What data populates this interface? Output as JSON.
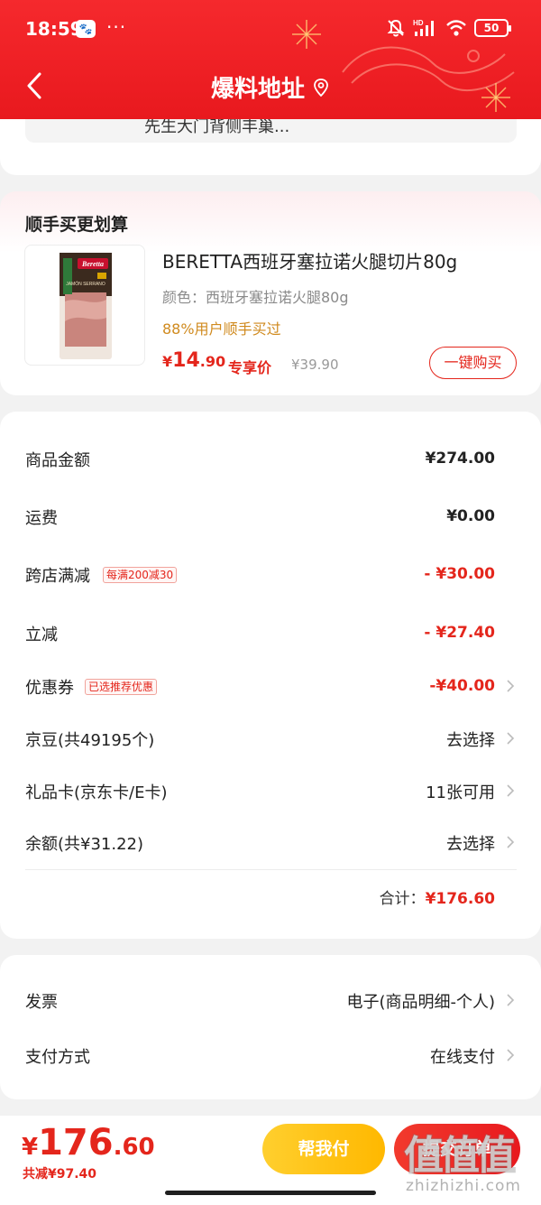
{
  "status_bar": {
    "time": "18:59",
    "app_badge": "🐾",
    "dots": "···",
    "network": "HD",
    "battery": "50"
  },
  "nav": {
    "title": "爆料地址"
  },
  "address": {
    "text": "先生大门背侧丰巢..."
  },
  "addon": {
    "section_title": "顺手买更划算",
    "product_name": "BERETTA西班牙塞拉诺火腿切片80g",
    "spec": "颜色：西班牙塞拉诺火腿80g",
    "bought_text": "88%用户顺手买过",
    "price_yen": "¥",
    "price_int": "14",
    "price_dec": ".90",
    "price_tag": "专享价",
    "original_price": "¥39.90",
    "buy_button": "一键购买",
    "image_brand": "Beretta",
    "image_caption": "JAMÓN SERRANO"
  },
  "summary": {
    "rows": [
      {
        "label": "商品金额",
        "value": "¥274.00"
      },
      {
        "label": "运费",
        "value": "¥0.00"
      },
      {
        "label": "跨店满减",
        "tag": "每满200减30",
        "value": "- ¥30.00"
      },
      {
        "label": "立减",
        "value": "- ¥27.40"
      },
      {
        "label": "优惠券",
        "tag": "已选推荐优惠",
        "value": "-¥40.00"
      },
      {
        "label": "京豆(共49195个)",
        "value": "去选择"
      },
      {
        "label": "礼品卡(京东卡/E卡)",
        "value": "11张可用"
      },
      {
        "label": "余额(共¥31.22)",
        "value": "去选择"
      }
    ],
    "total_label": "合计：",
    "total_value": "¥176.60"
  },
  "invoice": {
    "rows": [
      {
        "label": "发票",
        "value": "电子(商品明细-个人)"
      },
      {
        "label": "支付方式",
        "value": "在线支付"
      }
    ]
  },
  "bottom_bar": {
    "amount_yen": "¥",
    "amount_int": "176",
    "amount_dec": ".60",
    "saved": "共减¥97.40",
    "help_pay": "帮我付",
    "submit": "提交订单"
  },
  "watermark": {
    "glyphs": "值值值",
    "url": "zhizhizhi.com"
  },
  "colors": {
    "brand_red": "#e8191e",
    "price_red": "#e4261c",
    "help_yellow": "#ffc21a",
    "bought_orange": "#d08a1e"
  }
}
